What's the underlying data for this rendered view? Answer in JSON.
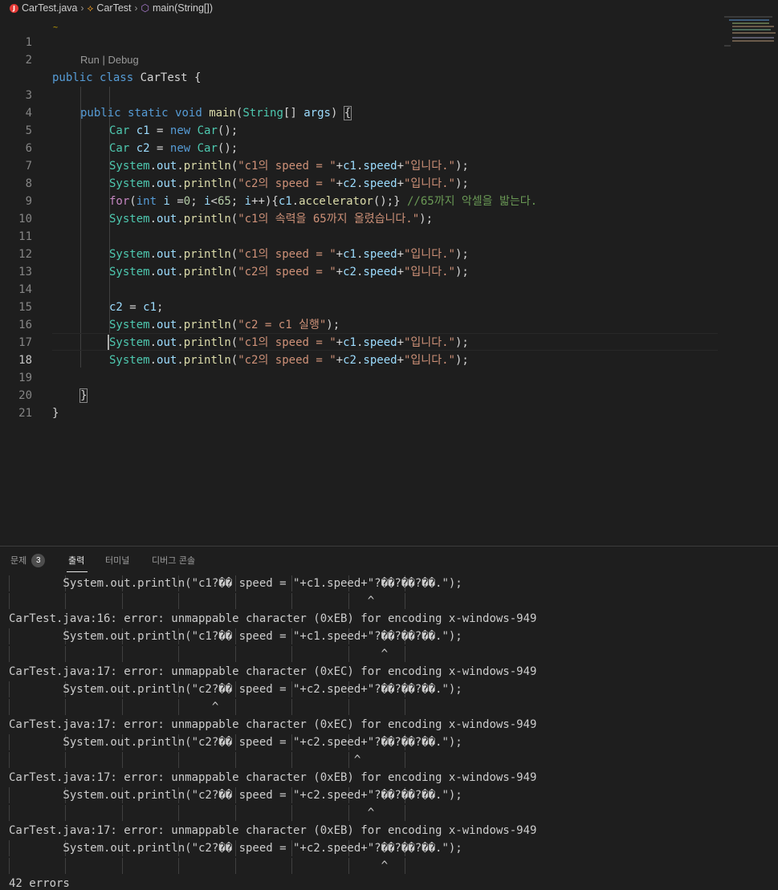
{
  "breadcrumb": {
    "file": "CarTest.java",
    "file_icon": "J",
    "class": "CarTest",
    "method": "main(String[])"
  },
  "editor": {
    "codelens": "Run | Debug",
    "line_numbers": [
      "1",
      "2",
      "3",
      "4",
      "5",
      "6",
      "7",
      "8",
      "9",
      "10",
      "11",
      "12",
      "13",
      "14",
      "15",
      "16",
      "17",
      "18",
      "19",
      "20",
      "21"
    ],
    "active_line": "18",
    "code": {
      "l1": "",
      "l2_a": "public",
      "l2_b": " ",
      "l2_c": "class",
      "l2_d": " CarTest {",
      "l3_a": "public",
      "l3_b": " ",
      "l3_c": "static",
      "l3_d": " ",
      "l3_e": "void",
      "l3_f": " ",
      "l3_g": "main",
      "l3_h": "(",
      "l3_i": "String",
      "l3_j": "[] ",
      "l3_k": "args",
      "l3_l": ") ",
      "l3_m": "{",
      "l4_a": "Car",
      "l4_b": " ",
      "l4_c": "c1",
      "l4_d": " = ",
      "l4_e": "new",
      "l4_f": " ",
      "l4_g": "Car",
      "l4_h": "();",
      "l5_a": "Car",
      "l5_b": " ",
      "l5_c": "c2",
      "l5_d": " = ",
      "l5_e": "new",
      "l5_f": " ",
      "l5_g": "Car",
      "l5_h": "();",
      "println_sys": "System",
      "println_dot": ".",
      "println_out": "out",
      "println_dot2": ".",
      "println_fn": "println",
      "l6_str1": "\"c1의 speed = \"",
      "l6_plus": "+",
      "l6_var": "c1",
      "l6_dot": ".",
      "l6_field": "speed",
      "l6_plus2": "+",
      "l6_str2": "\"입니다.\"",
      "l6_end": ");",
      "l7_str1": "\"c2의 speed = \"",
      "l7_plus": "+",
      "l7_var": "c2",
      "l7_dot": ".",
      "l7_field": "speed",
      "l7_plus2": "+",
      "l7_str2": "\"입니다.\"",
      "l7_end": ");",
      "l8_a": "for",
      "l8_b": "(",
      "l8_c": "int",
      "l8_d": " ",
      "l8_e": "i",
      "l8_f": " =",
      "l8_g": "0",
      "l8_h": "; ",
      "l8_i": "i",
      "l8_j": "<",
      "l8_k": "65",
      "l8_l": "; ",
      "l8_m": "i",
      "l8_n": "++){",
      "l8_o": "c1",
      "l8_p": ".",
      "l8_q": "accelerator",
      "l8_r": "();} ",
      "l8_s": "//65까지 악셀을 밟는다.",
      "l9_str": "\"c1의 속력을 65까지 올렸습니다.\"",
      "l9_end": ");",
      "l14_a": "c2",
      "l14_b": " = ",
      "l14_c": "c1",
      "l14_d": ";",
      "l15_str": "\"c2 = c1 실행\"",
      "l15_end": ");",
      "l19": "}",
      "l20": "}"
    }
  },
  "panel": {
    "tabs": [
      "문제",
      "출력",
      "터미널",
      "디버그 콘솔"
    ],
    "problems_count": "3",
    "active_tab": "출력",
    "output_lines": [
      "        System.out.println(\"c1?�� speed = \"+c1.speed+\"?��?��?��.\");",
      "                                                     ^",
      "CarTest.java:16: error: unmappable character (0xEB) for encoding x-windows-949",
      "        System.out.println(\"c1?�� speed = \"+c1.speed+\"?��?��?��.\");",
      "                                                       ^",
      "CarTest.java:17: error: unmappable character (0xEC) for encoding x-windows-949",
      "        System.out.println(\"c2?�� speed = \"+c2.speed+\"?��?��?��.\");",
      "                              ^",
      "CarTest.java:17: error: unmappable character (0xEC) for encoding x-windows-949",
      "        System.out.println(\"c2?�� speed = \"+c2.speed+\"?��?��?��.\");",
      "                                                   ^",
      "CarTest.java:17: error: unmappable character (0xEB) for encoding x-windows-949",
      "        System.out.println(\"c2?�� speed = \"+c2.speed+\"?��?��?��.\");",
      "                                                     ^",
      "CarTest.java:17: error: unmappable character (0xEB) for encoding x-windows-949",
      "        System.out.println(\"c2?�� speed = \"+c2.speed+\"?��?��?��.\");",
      "                                                       ^",
      "42 errors"
    ]
  },
  "colors": {
    "background": "#1e1e1e",
    "keyword": "#569cd6",
    "control": "#c586c0",
    "type": "#4ec9b0",
    "function": "#dcdcaa",
    "variable": "#9cdcfe",
    "string": "#ce9178",
    "number": "#b5cea8",
    "comment": "#6a9955"
  }
}
